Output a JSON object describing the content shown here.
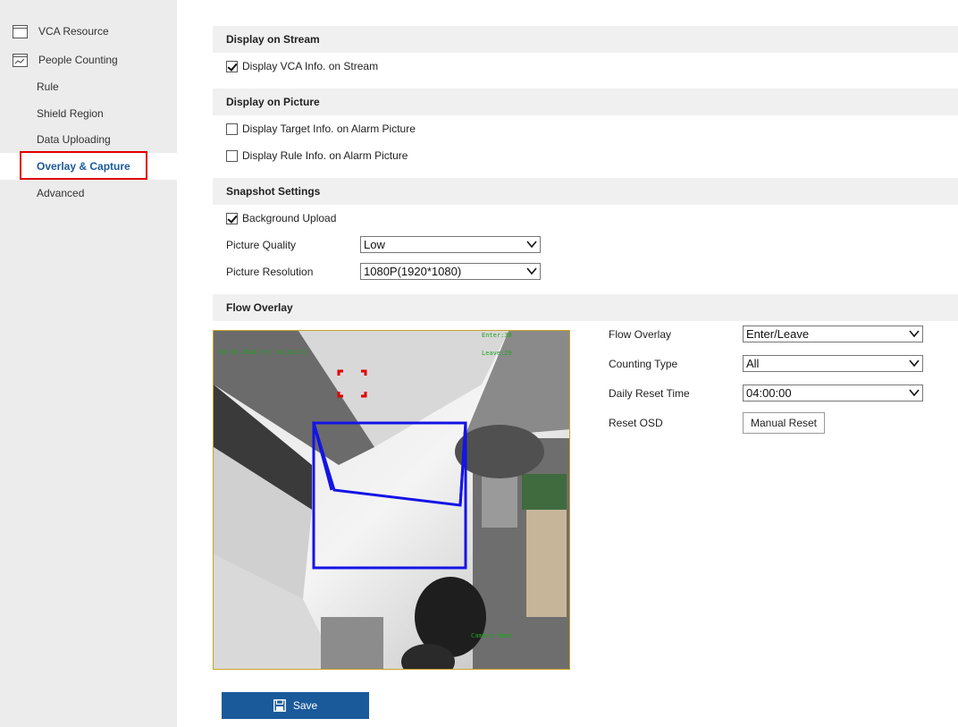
{
  "sidebar": {
    "vca_resource": "VCA Resource",
    "people_counting": "People Counting",
    "rule": "Rule",
    "shield_region": "Shield Region",
    "data_uploading": "Data Uploading",
    "overlay_capture": "Overlay & Capture",
    "advanced": "Advanced"
  },
  "display_on_stream": {
    "title": "Display on Stream",
    "vca_info": {
      "label": "Display VCA Info. on Stream",
      "checked": true
    }
  },
  "display_on_picture": {
    "title": "Display on Picture",
    "target_info": {
      "label": "Display Target Info. on Alarm Picture",
      "checked": false
    },
    "rule_info": {
      "label": "Display Rule Info. on Alarm Picture",
      "checked": false
    }
  },
  "snapshot": {
    "title": "Snapshot Settings",
    "background_upload": {
      "label": "Background Upload",
      "checked": true
    },
    "quality_label": "Picture Quality",
    "quality_value": "Low",
    "resolution_label": "Picture Resolution",
    "resolution_value": "1080P(1920*1080)"
  },
  "flow": {
    "title": "Flow Overlay",
    "overlay_label": "Flow Overlay",
    "overlay_value": "Enter/Leave",
    "counting_label": "Counting Type",
    "counting_value": "All",
    "reset_time_label": "Daily Reset Time",
    "reset_time_value": "04:00:00",
    "reset_osd_label": "Reset OSD",
    "manual_reset": "Manual Reset"
  },
  "video_osd": {
    "timestamp": "03-29-2024 Fri 10:24:21",
    "enter": "Enter:38",
    "leave": "Leave:29",
    "camera_name": "Camera Name"
  },
  "save_label": "Save",
  "colors": {
    "accent": "#1a5a9a",
    "highlight": "#e00000",
    "rule": "#1414e6",
    "osd": "#1fa31f"
  }
}
